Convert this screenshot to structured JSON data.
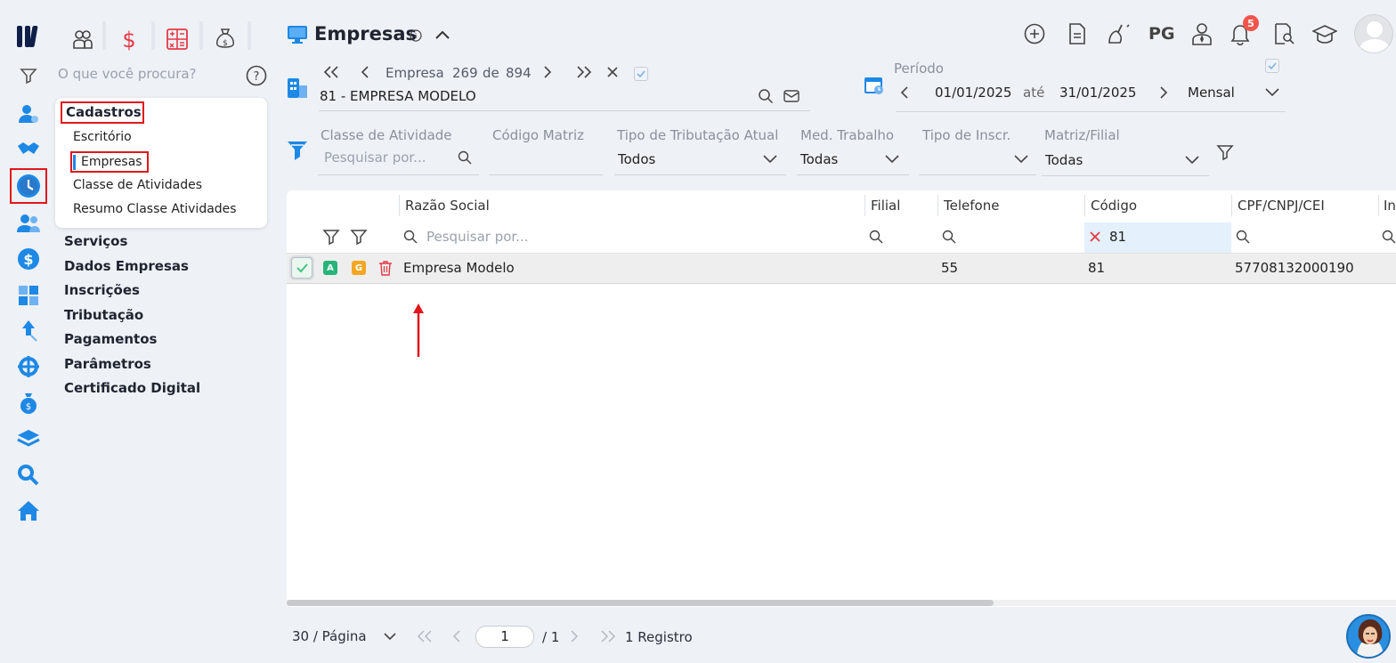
{
  "app": {
    "logo": "logo-icon",
    "modules": [
      "people-icon",
      "dollar-icon",
      "calculator-icon",
      "money-bag-icon"
    ]
  },
  "menu": {
    "search_placeholder": "O que você procura?",
    "cadastros": {
      "title": "Cadastros",
      "items": [
        "Escritório",
        "Empresas",
        "Classe de Atividades",
        "Resumo Classe Atividades"
      ]
    },
    "sections": [
      "Serviços",
      "Dados Empresas",
      "Inscrições",
      "Tributação",
      "Pagamentos",
      "Parâmetros",
      "Certificado Digital"
    ]
  },
  "header": {
    "title": "Empresas",
    "toolbar_pg": "PG",
    "notifications_count": "5"
  },
  "navigator": {
    "label": "Empresa",
    "current": "269",
    "of": "de",
    "total": "894",
    "selected": "81 - EMPRESA MODELO"
  },
  "period": {
    "label": "Período",
    "start": "01/01/2025",
    "until": "até",
    "end": "31/01/2025",
    "mode": "Mensal"
  },
  "filters": {
    "classe": {
      "label": "Classe de Atividade",
      "placeholder": "Pesquisar por..."
    },
    "codigo_matriz": {
      "label": "Código Matriz",
      "value": ""
    },
    "tributacao": {
      "label": "Tipo de Tributação Atual",
      "value": "Todos"
    },
    "med_trabalho": {
      "label": "Med. Trabalho",
      "value": "Todas"
    },
    "tipo_inscr": {
      "label": "Tipo de Inscr.",
      "value": ""
    },
    "matriz_filial": {
      "label": "Matriz/Filial",
      "value": "Todas"
    }
  },
  "table": {
    "columns": [
      "Razão Social",
      "Filial",
      "Telefone",
      "Código",
      "CPF/CNPJ/CEI",
      "In"
    ],
    "search_placeholder": "Pesquisar por...",
    "codigo_filter": "81",
    "rows": [
      {
        "badge_a": "A",
        "badge_g": "G",
        "razao_social": "Empresa Modelo",
        "filial": "",
        "telefone": "55",
        "codigo": "81",
        "cpf_cnpj": "57708132000190"
      }
    ]
  },
  "pagination": {
    "per_page": "30 / Página",
    "page": "1",
    "total_pages": "/ 1",
    "records": "1 Registro"
  },
  "colors": {
    "accent": "#1e88e5",
    "highlight": "#e0161b",
    "row_bg": "#eeeeee",
    "badge_a": "#26b47a",
    "badge_g": "#f5a623"
  }
}
